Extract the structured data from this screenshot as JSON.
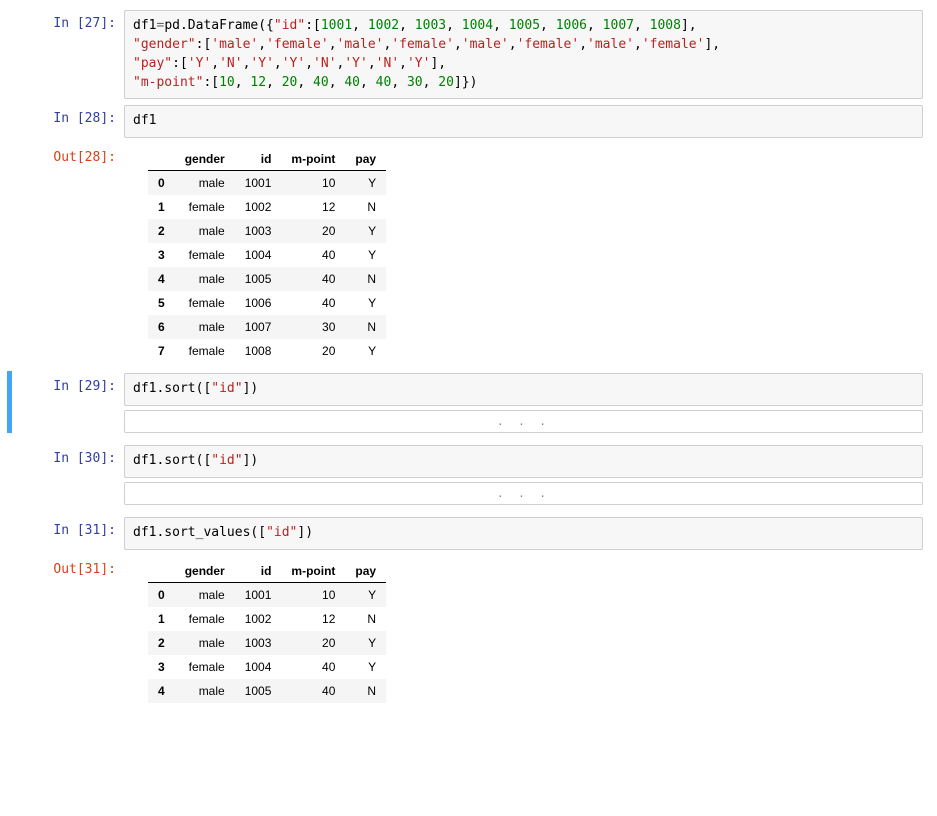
{
  "cells": {
    "c27": {
      "in_prompt": "In  [27]:",
      "code_tokens": [
        {
          "t": "df1",
          "c": ""
        },
        {
          "t": "=",
          "c": "c-op"
        },
        {
          "t": "pd.DataFrame",
          "c": "c-fn"
        },
        {
          "t": "({",
          "c": ""
        },
        {
          "t": "\"id\"",
          "c": "c-key"
        },
        {
          "t": ":[",
          "c": ""
        },
        {
          "t": "1001",
          "c": "c-num"
        },
        {
          "t": ", ",
          "c": ""
        },
        {
          "t": "1002",
          "c": "c-num"
        },
        {
          "t": ", ",
          "c": ""
        },
        {
          "t": "1003",
          "c": "c-num"
        },
        {
          "t": ", ",
          "c": ""
        },
        {
          "t": "1004",
          "c": "c-num"
        },
        {
          "t": ", ",
          "c": ""
        },
        {
          "t": "1005",
          "c": "c-num"
        },
        {
          "t": ", ",
          "c": ""
        },
        {
          "t": "1006",
          "c": "c-num"
        },
        {
          "t": ", ",
          "c": ""
        },
        {
          "t": "1007",
          "c": "c-num"
        },
        {
          "t": ", ",
          "c": ""
        },
        {
          "t": "1008",
          "c": "c-num"
        },
        {
          "t": "],",
          "c": ""
        },
        {
          "t": "\n",
          "c": ""
        },
        {
          "t": "\"gender\"",
          "c": "c-key"
        },
        {
          "t": ":[",
          "c": ""
        },
        {
          "t": "'male'",
          "c": "c-key"
        },
        {
          "t": ",",
          "c": ""
        },
        {
          "t": "'female'",
          "c": "c-key"
        },
        {
          "t": ",",
          "c": ""
        },
        {
          "t": "'male'",
          "c": "c-key"
        },
        {
          "t": ",",
          "c": ""
        },
        {
          "t": "'female'",
          "c": "c-key"
        },
        {
          "t": ",",
          "c": ""
        },
        {
          "t": "'male'",
          "c": "c-key"
        },
        {
          "t": ",",
          "c": ""
        },
        {
          "t": "'female'",
          "c": "c-key"
        },
        {
          "t": ",",
          "c": ""
        },
        {
          "t": "'male'",
          "c": "c-key"
        },
        {
          "t": ",",
          "c": ""
        },
        {
          "t": "'female'",
          "c": "c-key"
        },
        {
          "t": "],",
          "c": ""
        },
        {
          "t": "\n",
          "c": ""
        },
        {
          "t": "\"pay\"",
          "c": "c-key"
        },
        {
          "t": ":[",
          "c": ""
        },
        {
          "t": "'Y'",
          "c": "c-key"
        },
        {
          "t": ",",
          "c": ""
        },
        {
          "t": "'N'",
          "c": "c-key"
        },
        {
          "t": ",",
          "c": ""
        },
        {
          "t": "'Y'",
          "c": "c-key"
        },
        {
          "t": ",",
          "c": ""
        },
        {
          "t": "'Y'",
          "c": "c-key"
        },
        {
          "t": ",",
          "c": ""
        },
        {
          "t": "'N'",
          "c": "c-key"
        },
        {
          "t": ",",
          "c": ""
        },
        {
          "t": "'Y'",
          "c": "c-key"
        },
        {
          "t": ",",
          "c": ""
        },
        {
          "t": "'N'",
          "c": "c-key"
        },
        {
          "t": ",",
          "c": ""
        },
        {
          "t": "'Y'",
          "c": "c-key"
        },
        {
          "t": "],",
          "c": ""
        },
        {
          "t": "\n",
          "c": ""
        },
        {
          "t": "\"m-point\"",
          "c": "c-key"
        },
        {
          "t": ":[",
          "c": ""
        },
        {
          "t": "10",
          "c": "c-num"
        },
        {
          "t": ", ",
          "c": ""
        },
        {
          "t": "12",
          "c": "c-num"
        },
        {
          "t": ", ",
          "c": ""
        },
        {
          "t": "20",
          "c": "c-num"
        },
        {
          "t": ", ",
          "c": ""
        },
        {
          "t": "40",
          "c": "c-num"
        },
        {
          "t": ", ",
          "c": ""
        },
        {
          "t": "40",
          "c": "c-num"
        },
        {
          "t": ", ",
          "c": ""
        },
        {
          "t": "40",
          "c": "c-num"
        },
        {
          "t": ", ",
          "c": ""
        },
        {
          "t": "30",
          "c": "c-num"
        },
        {
          "t": ", ",
          "c": ""
        },
        {
          "t": "20",
          "c": "c-num"
        },
        {
          "t": "]})",
          "c": ""
        }
      ]
    },
    "c28": {
      "in_prompt": "In  [28]:",
      "out_prompt": "Out[28]:",
      "code": "df1",
      "table": {
        "columns": [
          "gender",
          "id",
          "m-point",
          "pay"
        ],
        "rows": [
          {
            "idx": "0",
            "vals": [
              "male",
              "1001",
              "10",
              "Y"
            ]
          },
          {
            "idx": "1",
            "vals": [
              "female",
              "1002",
              "12",
              "N"
            ]
          },
          {
            "idx": "2",
            "vals": [
              "male",
              "1003",
              "20",
              "Y"
            ]
          },
          {
            "idx": "3",
            "vals": [
              "female",
              "1004",
              "40",
              "Y"
            ]
          },
          {
            "idx": "4",
            "vals": [
              "male",
              "1005",
              "40",
              "N"
            ]
          },
          {
            "idx": "5",
            "vals": [
              "female",
              "1006",
              "40",
              "Y"
            ]
          },
          {
            "idx": "6",
            "vals": [
              "male",
              "1007",
              "30",
              "N"
            ]
          },
          {
            "idx": "7",
            "vals": [
              "female",
              "1008",
              "20",
              "Y"
            ]
          }
        ]
      }
    },
    "c29": {
      "in_prompt": "In  [29]:",
      "code_tokens": [
        {
          "t": "df1.sort([",
          "c": ""
        },
        {
          "t": "\"id\"",
          "c": "c-key"
        },
        {
          "t": "])",
          "c": ""
        }
      ],
      "collapsed_label": ". . ."
    },
    "c30": {
      "in_prompt": "In  [30]:",
      "code_tokens": [
        {
          "t": "df1.sort([",
          "c": ""
        },
        {
          "t": "\"id\"",
          "c": "c-key"
        },
        {
          "t": "])",
          "c": ""
        }
      ],
      "collapsed_label": ". . ."
    },
    "c31": {
      "in_prompt": "In  [31]:",
      "out_prompt": "Out[31]:",
      "code_tokens": [
        {
          "t": "df1.sort_values([",
          "c": ""
        },
        {
          "t": "\"id\"",
          "c": "c-key"
        },
        {
          "t": "])",
          "c": ""
        }
      ],
      "table": {
        "columns": [
          "gender",
          "id",
          "m-point",
          "pay"
        ],
        "rows": [
          {
            "idx": "0",
            "vals": [
              "male",
              "1001",
              "10",
              "Y"
            ]
          },
          {
            "idx": "1",
            "vals": [
              "female",
              "1002",
              "12",
              "N"
            ]
          },
          {
            "idx": "2",
            "vals": [
              "male",
              "1003",
              "20",
              "Y"
            ]
          },
          {
            "idx": "3",
            "vals": [
              "female",
              "1004",
              "40",
              "Y"
            ]
          },
          {
            "idx": "4",
            "vals": [
              "male",
              "1005",
              "40",
              "N"
            ]
          }
        ]
      }
    }
  }
}
